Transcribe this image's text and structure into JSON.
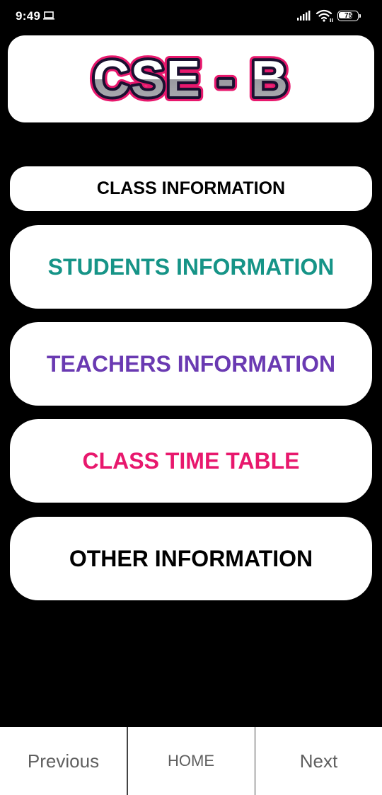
{
  "status_bar": {
    "time": "9:49",
    "battery_level": "75",
    "icons": [
      "laptop-icon",
      "signal-icon",
      "wifi-icon",
      "battery-icon"
    ]
  },
  "header": {
    "logo_text": "CSE - B"
  },
  "menu": {
    "class_info": {
      "label": "CLASS INFORMATION",
      "color": "#000000"
    },
    "students": {
      "label": "STUDENTS INFORMATION",
      "color": "#169487"
    },
    "teachers": {
      "label": "TEACHERS INFORMATION",
      "color": "#6a3ab2"
    },
    "timetable": {
      "label": "CLASS TIME TABLE",
      "color": "#e8186d"
    },
    "other": {
      "label": "OTHER INFORMATION",
      "color": "#000000"
    }
  },
  "bottom_nav": {
    "previous": "Previous",
    "home": "HOME",
    "next": "Next"
  },
  "colors": {
    "background": "#000000",
    "card": "#ffffff",
    "logo_outline": "#e8186d",
    "nav_text": "#5f5f5f"
  }
}
